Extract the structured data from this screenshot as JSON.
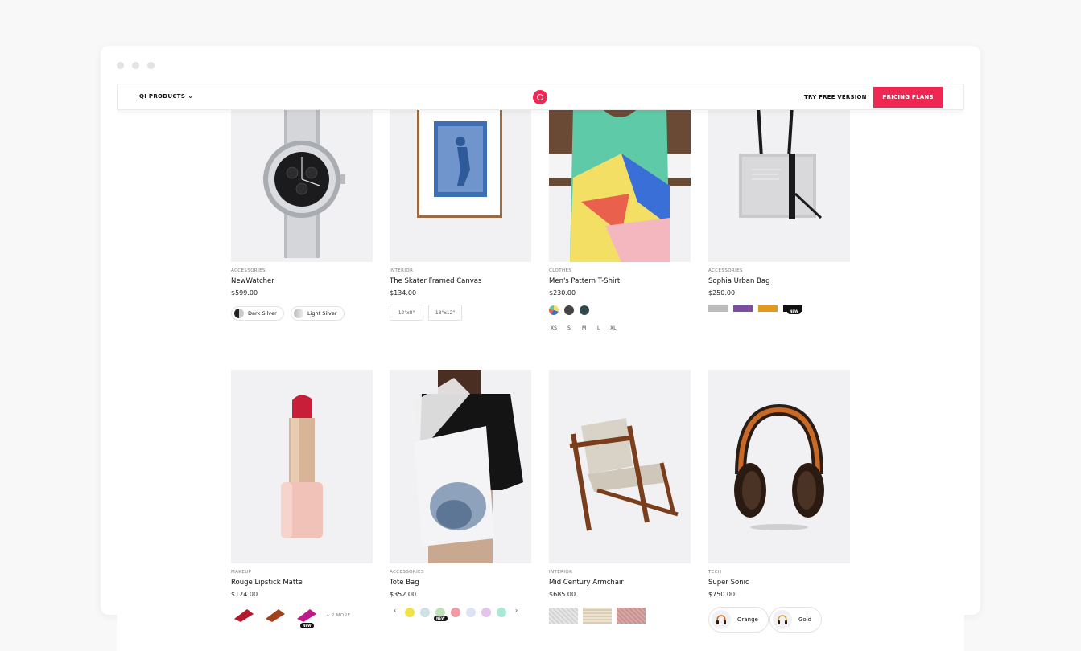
{
  "nav": {
    "products_label": "QI PRODUCTS",
    "try_free_label": "TRY FREE VERSION",
    "pricing_label": "PRICING PLANS",
    "accent": "#ee2852"
  },
  "products": [
    {
      "category": "ACCESSORIES",
      "title": "NewWatcher",
      "price": "$599.00",
      "variants": [
        "Dark Silver",
        "Light Silver"
      ]
    },
    {
      "category": "INTERIOR",
      "title": "The Skater Framed Canvas",
      "price": "$134.00",
      "variants": [
        "12\"x8\"",
        "18\"x12\""
      ]
    },
    {
      "category": "CLOTHES",
      "title": "Men's Pattern T-Shirt",
      "price": "$230.00",
      "sizes": [
        "XS",
        "S",
        "M",
        "L",
        "XL"
      ]
    },
    {
      "category": "ACCESSORIES",
      "title": "Sophia Urban Bag",
      "price": "$250.00",
      "badge": "NEW"
    },
    {
      "category": "MAKEUP",
      "title": "Rouge Lipstick Matte",
      "price": "$124.00",
      "badge": "NEW",
      "more": "+ 2 MORE"
    },
    {
      "category": "ACCESSORIES",
      "title": "Tote Bag",
      "price": "$352.00",
      "badge": "NEW",
      "prev": "‹",
      "next": "›"
    },
    {
      "category": "INTERIOR",
      "title": "Mid Century Armchair",
      "price": "$685.00"
    },
    {
      "category": "TECH",
      "title": "Super Sonic",
      "price": "$750.00",
      "variants": [
        "Orange",
        "Gold"
      ]
    }
  ]
}
